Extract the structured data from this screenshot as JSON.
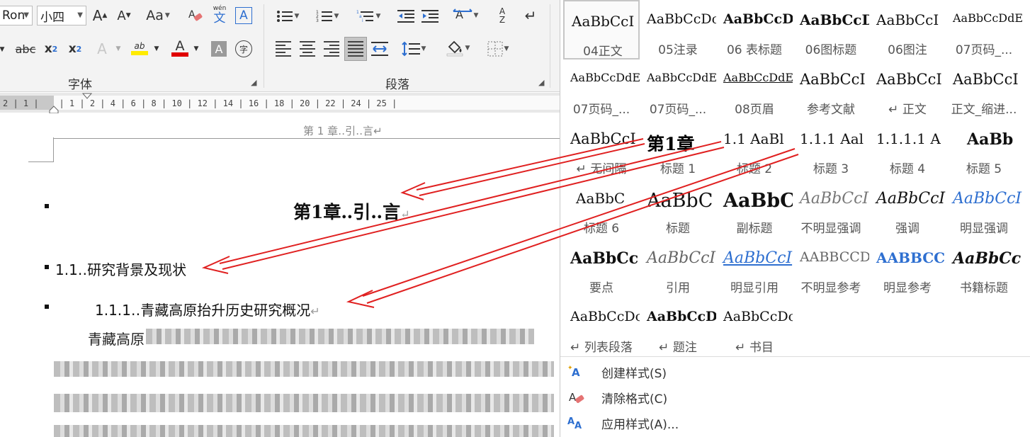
{
  "ribbon": {
    "font_name": "Ron",
    "font_size": "小四",
    "font_group_label": "字体",
    "paragraph_group_label": "段落",
    "grow_font_glyph": "A",
    "shrink_font_glyph": "A",
    "change_case_label": "Aa",
    "phonetic_label": "wén",
    "phonetic_char": "文",
    "char_border_glyph": "A",
    "strike_label": "abc",
    "subscript_label": "x",
    "subscript_sub": "2",
    "superscript_label": "x",
    "superscript_sup": "2",
    "text_effect_glyph": "A",
    "highlight_label": "ab",
    "font_color_glyph": "A",
    "char_shading_glyph": "A",
    "enclose_char": "字",
    "sort_label_a": "A",
    "sort_label_z": "Z",
    "colors": {
      "highlight": "#ffeb00",
      "font_color": "#e00000"
    }
  },
  "ruler": {
    "numbers": "│2│1│   │1│2│4│6│8│10│12│14│16│18│20│22│24│26│28│30│32│34│36│38│40│42│44│46│48│50",
    "numbers_display": "2 | 1 |    | 1 | 2 | 4 | 6 | 8 | 10 | 12 | 14 | 16 | 18 | 20 | 22 | 24 | 25 |"
  },
  "document": {
    "header": "第 1 章‥引‥言↵",
    "heading1": "第1章‥引‥言",
    "heading2": "1.1‥研究背景及现状",
    "heading3": "1.1.1‥青藏高原抬升历史研究概况",
    "paragraph_start": "青藏高原",
    "return_mark": "↵"
  },
  "gallery": {
    "styles": [
      {
        "preview": "AaBbCcI",
        "name": "04正文"
      },
      {
        "preview": "AaBbCcDc",
        "name": "05注录"
      },
      {
        "preview": "AaBbCcD",
        "name": "06 表标题"
      },
      {
        "preview": "AaBbCcD",
        "name": "06图标题"
      },
      {
        "preview": "AaBbCcI",
        "name": "06图注"
      },
      {
        "preview": "AaBbCcDdE",
        "name": "07页码_..."
      },
      {
        "preview": "AaBbCcDdE",
        "name": "07页码_..."
      },
      {
        "preview": "AaBbCcDdE",
        "name": "07页码_..."
      },
      {
        "preview": "AaBbCcDdEe",
        "name": "08页眉"
      },
      {
        "preview": "AaBbCcI",
        "name": "参考文献"
      },
      {
        "preview": "AaBbCcI",
        "name": "↵ 正文"
      },
      {
        "preview": "AaBbCcI",
        "name": "正文_缩进..."
      },
      {
        "preview": "AaBbCcI",
        "name": "↵ 无间隔"
      },
      {
        "preview": "第1章",
        "name": "标题 1"
      },
      {
        "preview": "1.1  AaBl",
        "name": "标题 2"
      },
      {
        "preview": "1.1.1  Aal",
        "name": "标题 3"
      },
      {
        "preview": "1.1.1.1  A",
        "name": "标题 4"
      },
      {
        "preview": "AaBb",
        "name": "标题 5"
      },
      {
        "preview": "AaBbC",
        "name": "标题 6"
      },
      {
        "preview": "AaBbC",
        "name": "标题"
      },
      {
        "preview": "AaBbC",
        "name": "副标题"
      },
      {
        "preview": "AaBbCcI",
        "name": "不明显强调"
      },
      {
        "preview": "AaBbCcI",
        "name": "强调"
      },
      {
        "preview": "AaBbCcI",
        "name": "明显强调"
      },
      {
        "preview": "AaBbCc",
        "name": "要点"
      },
      {
        "preview": "AaBbCcI",
        "name": "引用"
      },
      {
        "preview": "AaBbCcI",
        "name": "明显引用"
      },
      {
        "preview": "AABBCCDI",
        "name": "不明显参考"
      },
      {
        "preview": "AABBCCI",
        "name": "明显参考"
      },
      {
        "preview": "AaBbCc",
        "name": "书籍标题"
      },
      {
        "preview": "AaBbCcDc",
        "name": "↵ 列表段落"
      },
      {
        "preview": "AaBbCcD",
        "name": "↵ 题注"
      },
      {
        "preview": "AaBbCcDc",
        "name": "↵ 书目"
      }
    ],
    "commands": [
      {
        "label": "创建样式(S)"
      },
      {
        "label": "清除格式(C)"
      },
      {
        "label": "应用样式(A)..."
      }
    ],
    "colors": {
      "accent_blue": "#2e6fd0",
      "arrow_red": "#e02020"
    }
  }
}
